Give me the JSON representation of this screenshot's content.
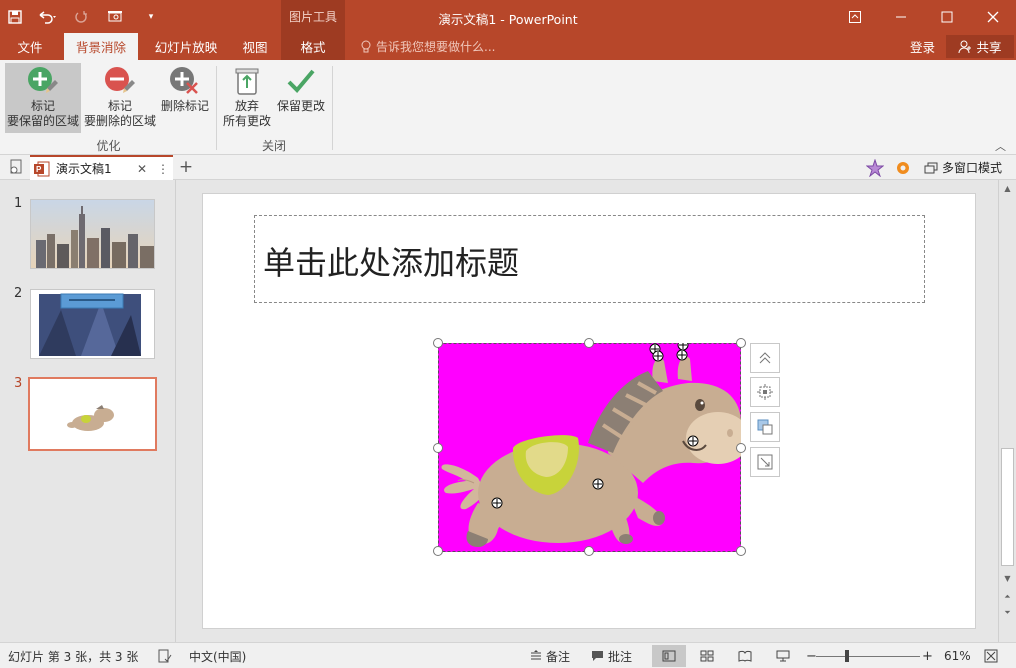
{
  "app": {
    "title": "演示文稿1 - PowerPoint",
    "contextual_tools": "图片工具"
  },
  "tabs": {
    "file": "文件",
    "background_removal": "背景消除",
    "slideshow": "幻灯片放映",
    "view": "视图",
    "format": "格式",
    "tell_me": "告诉我您想要做什么...",
    "login": "登录",
    "share": "共享"
  },
  "ribbon": {
    "mark_keep_line1": "标记",
    "mark_keep_line2": "要保留的区域",
    "mark_remove_line1": "标记",
    "mark_remove_line2": "要删除的区域",
    "delete_mark": "删除标记",
    "group_refine": "优化",
    "discard_line1": "放弃",
    "discard_line2": "所有更改",
    "keep_changes": "保留更改",
    "group_close": "关闭"
  },
  "doc_tabs": {
    "active_doc": "演示文稿1",
    "multi_window": "多窗口模式"
  },
  "thumbnails": {
    "items": [
      {
        "number": "1"
      },
      {
        "number": "2"
      },
      {
        "number": "3"
      }
    ]
  },
  "slide": {
    "title_placeholder": "单击此处添加标题"
  },
  "status": {
    "slide_info": "幻灯片 第 3 张，共 3 张",
    "language": "中文(中国)",
    "notes": "备注",
    "comments": "批注",
    "zoom_percent": "61%"
  },
  "colors": {
    "accent": "#b7472a",
    "removal_magenta": "#ff00ff",
    "keep_green": "#4aa564",
    "remove_red": "#d9534f"
  }
}
